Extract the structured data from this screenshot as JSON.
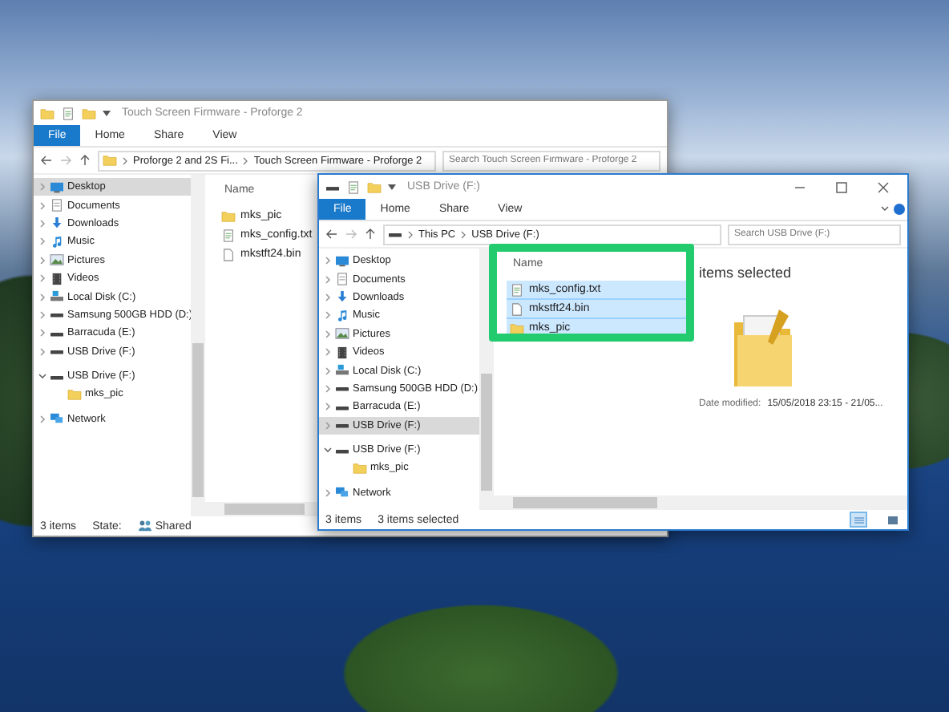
{
  "windows": [
    {
      "title": "Touch Screen Firmware - Proforge 2",
      "active": false,
      "ribbon_tabs": [
        {
          "label": "File",
          "selected": true
        },
        {
          "label": "Home",
          "selected": false
        },
        {
          "label": "Share",
          "selected": false
        },
        {
          "label": "View",
          "selected": false
        }
      ],
      "address": [
        "Proforge 2 and 2S Fi...",
        "Touch Screen Firmware - Proforge 2"
      ],
      "search": {
        "placeholder": "Search Touch Screen Firmware - Proforge 2"
      },
      "nav_sections": [
        [
          {
            "label": "Desktop",
            "kind": "desktop",
            "expanded": false,
            "selected": true
          },
          {
            "label": "Documents",
            "kind": "documents",
            "expanded": false,
            "selected": false
          },
          {
            "label": "Downloads",
            "kind": "downloads",
            "expanded": false,
            "selected": false
          },
          {
            "label": "Music",
            "kind": "music",
            "expanded": false,
            "selected": false
          },
          {
            "label": "Pictures",
            "kind": "pictures",
            "expanded": false,
            "selected": false
          },
          {
            "label": "Videos",
            "kind": "videos",
            "expanded": false,
            "selected": false
          },
          {
            "label": "Local Disk (C:)",
            "kind": "disk",
            "expanded": false,
            "selected": false
          },
          {
            "label": "Samsung 500GB HDD (D:)",
            "kind": "drive",
            "expanded": false,
            "selected": false
          },
          {
            "label": "Barracuda (E:)",
            "kind": "drive",
            "expanded": false,
            "selected": false
          },
          {
            "label": "USB Drive (F:)",
            "kind": "drive",
            "expanded": false,
            "selected": false
          }
        ],
        [
          {
            "label": "USB Drive (F:)",
            "kind": "drive",
            "expanded": true,
            "selected": false,
            "children": [
              {
                "label": "mks_pic",
                "kind": "folder",
                "selected": false
              }
            ]
          }
        ],
        [
          {
            "label": "Network",
            "kind": "network",
            "expanded": false,
            "selected": false
          }
        ]
      ],
      "column_header": "Name",
      "files": [
        {
          "name": "mks_pic",
          "kind": "folder",
          "selected": false
        },
        {
          "name": "mks_config.txt",
          "kind": "text",
          "selected": false
        },
        {
          "name": "mkstft24.bin",
          "kind": "file",
          "selected": false
        }
      ],
      "status": [
        {
          "text": "3 items",
          "kind": "text"
        },
        {
          "text": "State:",
          "kind": "text"
        },
        {
          "text": "Shared",
          "kind": "shared"
        }
      ]
    },
    {
      "title": "USB Drive (F:)",
      "active": true,
      "ribbon_tabs": [
        {
          "label": "File",
          "selected": true
        },
        {
          "label": "Home",
          "selected": false
        },
        {
          "label": "Share",
          "selected": false
        },
        {
          "label": "View",
          "selected": false
        }
      ],
      "address": [
        "This PC",
        "USB Drive (F:)"
      ],
      "search": {
        "placeholder": "Search USB Drive (F:)"
      },
      "nav_sections": [
        [
          {
            "label": "Desktop",
            "kind": "desktop",
            "expanded": false,
            "selected": false
          },
          {
            "label": "Documents",
            "kind": "documents",
            "expanded": false,
            "selected": false
          },
          {
            "label": "Downloads",
            "kind": "downloads",
            "expanded": false,
            "selected": false
          },
          {
            "label": "Music",
            "kind": "music",
            "expanded": false,
            "selected": false
          },
          {
            "label": "Pictures",
            "kind": "pictures",
            "expanded": false,
            "selected": false
          },
          {
            "label": "Videos",
            "kind": "videos",
            "expanded": false,
            "selected": false
          },
          {
            "label": "Local Disk (C:)",
            "kind": "disk",
            "expanded": false,
            "selected": false
          },
          {
            "label": "Samsung 500GB HDD (D:)",
            "kind": "drive",
            "expanded": false,
            "selected": false
          },
          {
            "label": "Barracuda (E:)",
            "kind": "drive",
            "expanded": false,
            "selected": false
          },
          {
            "label": "USB Drive (F:)",
            "kind": "drive",
            "expanded": false,
            "selected": true
          }
        ],
        [
          {
            "label": "USB Drive (F:)",
            "kind": "drive",
            "expanded": true,
            "selected": false,
            "children": [
              {
                "label": "mks_pic",
                "kind": "folder",
                "selected": false
              }
            ]
          }
        ],
        [
          {
            "label": "Network",
            "kind": "network",
            "expanded": false,
            "selected": false
          }
        ]
      ],
      "column_header": "Name",
      "files": [
        {
          "name": "mks_config.txt",
          "kind": "text",
          "selected": true
        },
        {
          "name": "mkstft24.bin",
          "kind": "file",
          "selected": true
        },
        {
          "name": "mks_pic",
          "kind": "folder",
          "selected": true
        }
      ],
      "details": {
        "heading": "items selected",
        "label": "Date modified:",
        "value": "15/05/2018 23:15 - 21/05..."
      },
      "status": [
        {
          "text": "3 items",
          "kind": "text"
        },
        {
          "text": "3 items selected",
          "kind": "text"
        }
      ]
    }
  ],
  "highlight": true
}
